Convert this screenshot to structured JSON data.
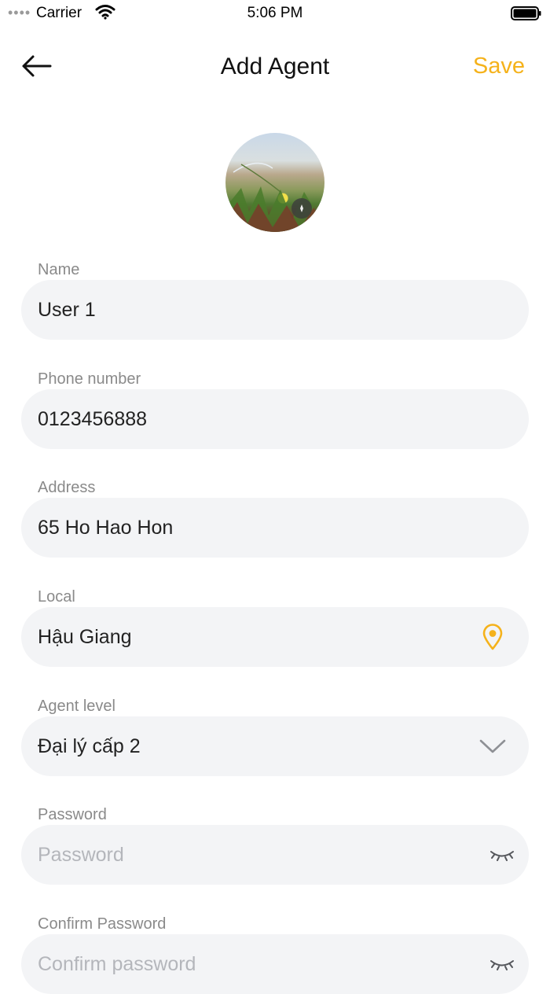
{
  "status_bar": {
    "signal": "••••",
    "carrier": "Carrier",
    "time": "5:06 PM"
  },
  "nav": {
    "title": "Add Agent",
    "save_label": "Save",
    "back_icon": "arrow-left-icon"
  },
  "avatar": {
    "icon": "camera-icon"
  },
  "form": {
    "name": {
      "label": "Name",
      "value": "User 1"
    },
    "phone": {
      "label": "Phone number",
      "value": "0123456888"
    },
    "address": {
      "label": "Address",
      "value": "65 Ho Hao Hon"
    },
    "local": {
      "label": "Local",
      "value": "Hậu Giang",
      "icon": "location-pin-icon"
    },
    "agent_level": {
      "label": "Agent level",
      "value": "Đại lý cấp 2",
      "icon": "chevron-down-icon"
    },
    "password": {
      "label": "Password",
      "placeholder": "Password",
      "icon": "eye-closed-icon"
    },
    "confirm_password": {
      "label": "Confirm Password",
      "placeholder": "Confirm password",
      "icon": "eye-closed-icon"
    }
  },
  "colors": {
    "accent": "#f5b21b",
    "field_background": "#f3f4f6",
    "label": "#8a8a8a",
    "placeholder": "#b4b6bb"
  }
}
